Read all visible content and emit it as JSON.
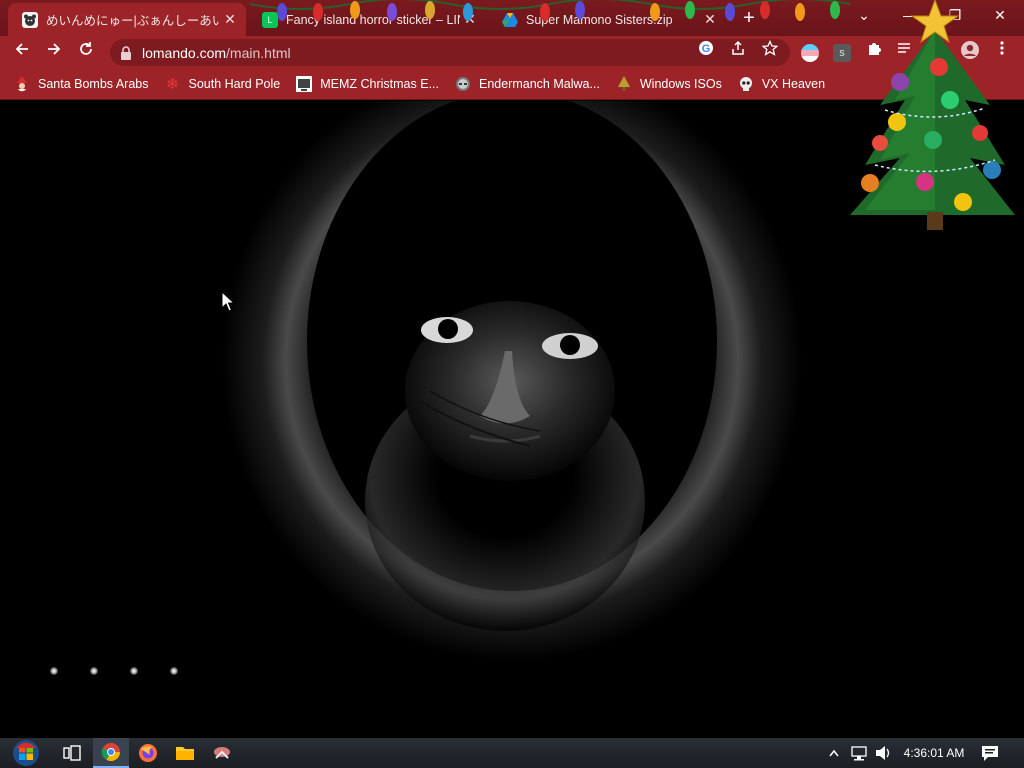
{
  "browser": {
    "tabs": [
      {
        "title": "めいんめにゅー|ぶぁんしーあいらんど",
        "active": true,
        "favicon": "bear-icon"
      },
      {
        "title": "Fancy island horror sticker – LINE",
        "active": false,
        "favicon": "line-icon"
      },
      {
        "title": "Super Mamono Sisters.zip",
        "active": false,
        "favicon": "drive-icon"
      }
    ],
    "url_host": "lomando.com",
    "url_path": "/main.html",
    "window_controls": {
      "minimize": "—",
      "restore": "❐",
      "close": "✕"
    },
    "new_tab": "+",
    "tab_search": "⌄",
    "extension_s_label": "s"
  },
  "bookmarks": [
    {
      "label": "Santa Bombs Arabs",
      "icon": "santa-icon"
    },
    {
      "label": "South Hard Pole",
      "icon": "snowflake-icon"
    },
    {
      "label": "MEMZ Christmas E...",
      "icon": "memz-icon"
    },
    {
      "label": "Endermanch Malwa...",
      "icon": "enderman-icon"
    },
    {
      "label": "Windows ISOs",
      "icon": "tree-icon"
    },
    {
      "label": "VX Heaven",
      "icon": "skull-icon"
    }
  ],
  "page": {
    "loading_dots_count": 4
  },
  "taskbar": {
    "apps": [
      "start-orb",
      "task-view",
      "chrome",
      "firefox",
      "file-explorer",
      "snipping-tool"
    ],
    "clock": "4:36:01 AM"
  },
  "colors": {
    "chrome_frame": "#7a1a1f",
    "chrome_toolbar": "#9c2428",
    "page_bg": "#000000",
    "taskbar": "#1f2328"
  }
}
